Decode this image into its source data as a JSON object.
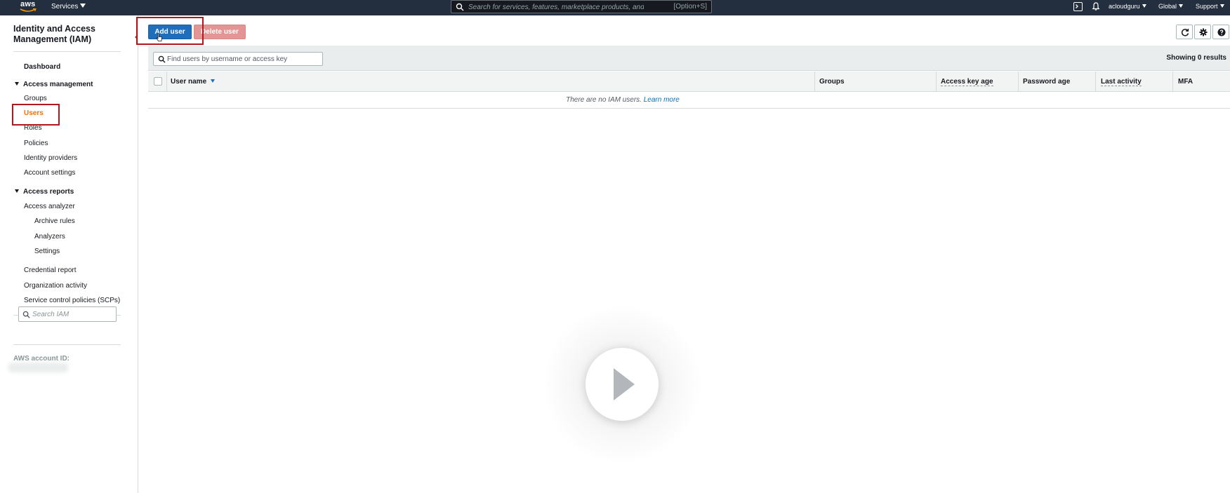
{
  "topbar": {
    "logo_text": "aws",
    "services_label": "Services",
    "search_placeholder": "Search for services, features, marketplace products, and docs",
    "search_shortcut": "[Option+S]",
    "account_label": "acloudguru",
    "region_label": "Global",
    "support_label": "Support"
  },
  "sidebar": {
    "title": "Identity and Access Management (IAM)",
    "dashboard": "Dashboard",
    "access_management": {
      "label": "Access management",
      "items": [
        "Groups",
        "Users",
        "Roles",
        "Policies",
        "Identity providers",
        "Account settings"
      ],
      "active": "Users"
    },
    "access_reports": {
      "label": "Access reports",
      "access_analyzer": "Access analyzer",
      "analyzer_items": [
        "Archive rules",
        "Analyzers",
        "Settings"
      ],
      "items": [
        "Credential report",
        "Organization activity",
        "Service control policies (SCPs)"
      ]
    },
    "search_placeholder": "Search IAM",
    "account_id_label": "AWS account ID:"
  },
  "toolbar": {
    "add_user": "Add user",
    "delete_user": "Delete user"
  },
  "filter": {
    "placeholder": "Find users by username or access key",
    "showing": "Showing 0 results"
  },
  "table": {
    "columns": [
      "User name",
      "Groups",
      "Access key age",
      "Password age",
      "Last activity",
      "MFA"
    ],
    "empty_message": "There are no IAM users.",
    "learn_more": "Learn more"
  },
  "colors": {
    "topbar_bg": "#232f3e",
    "primary_button": "#1f6ebc",
    "danger_disabled": "#e39494",
    "active_nav": "#ec7211",
    "highlight": "#b0171f",
    "link": "#0073bb"
  }
}
